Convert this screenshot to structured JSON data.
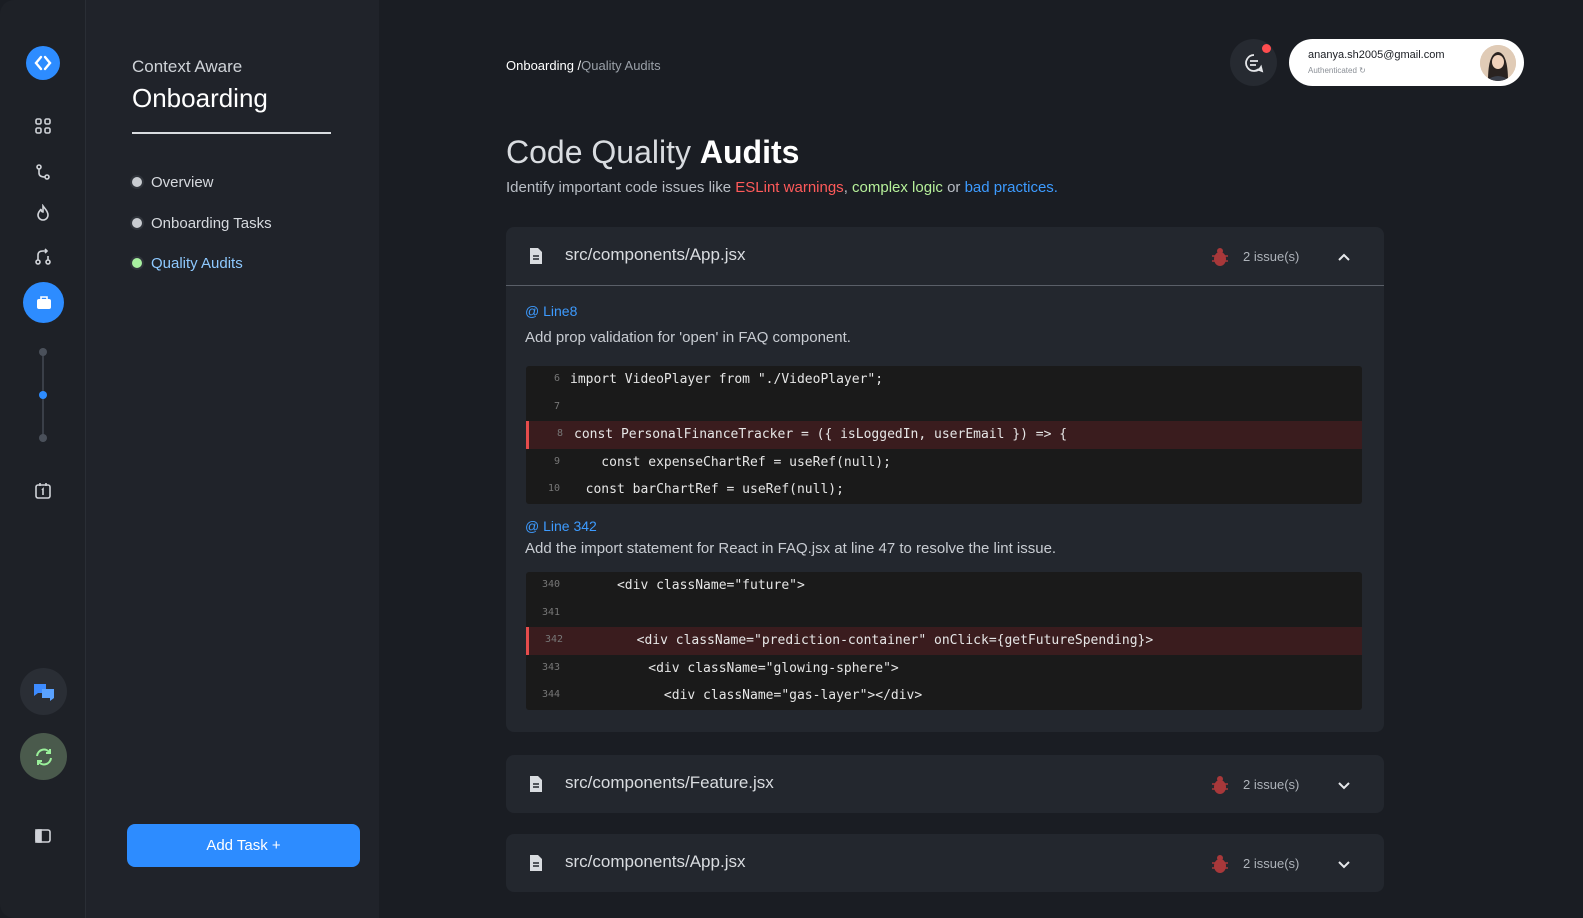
{
  "sidebar": {
    "subtitle": "Context Aware",
    "title": "Onboarding",
    "items": [
      {
        "label": "Overview",
        "active": false
      },
      {
        "label": "Onboarding Tasks",
        "active": false
      },
      {
        "label": "Quality Audits",
        "active": true
      }
    ],
    "add_task_label": "Add Task +"
  },
  "rail": {
    "icons": [
      "logo-icon",
      "dashboard-icon",
      "git-branch-icon",
      "flame-icon",
      "pull-request-icon",
      "briefcase-icon",
      "calendar-icon",
      "chat-icon",
      "sync-icon",
      "sidebar-toggle-icon"
    ]
  },
  "header": {
    "breadcrumb_root": "Onboarding /",
    "breadcrumb_current": "Quality Audits",
    "user_email": "ananya.sh2005@gmail.com",
    "user_status": "Authenticated"
  },
  "page": {
    "title_light": "Code Quality ",
    "title_bold": "Audits",
    "desc_prefix": "Identify important code issues like ",
    "desc_red": "ESLint warnings",
    "desc_comma": ", ",
    "desc_green": "complex logic",
    "desc_or": " or ",
    "desc_blue": "bad practices."
  },
  "files": [
    {
      "name": "src/components/App.jsx",
      "issues_label": "2 issue(s)",
      "expanded": true,
      "issues": [
        {
          "line_label": "@ Line8",
          "message": "Add prop validation for 'open' in FAQ component.",
          "code": [
            {
              "n": "6",
              "text": "import VideoPlayer from \"./VideoPlayer\";",
              "hl": false
            },
            {
              "n": "7",
              "text": "",
              "hl": false
            },
            {
              "n": "8",
              "text": "const PersonalFinanceTracker = ({ isLoggedIn, userEmail }) => {",
              "hl": true
            },
            {
              "n": "9",
              "text": "    const expenseChartRef = useRef(null);",
              "hl": false
            },
            {
              "n": "10",
              "text": "  const barChartRef = useRef(null);",
              "hl": false
            }
          ]
        },
        {
          "line_label": "@ Line 342",
          "message": "Add the import statement for React in FAQ.jsx at line 47 to resolve the lint issue.",
          "code": [
            {
              "n": "340",
              "text": "      <div className=\"future\">",
              "hl": false
            },
            {
              "n": "341",
              "text": "",
              "hl": false
            },
            {
              "n": "342",
              "text": "        <div className=\"prediction-container\" onClick={getFutureSpending}>",
              "hl": true
            },
            {
              "n": "343",
              "text": "          <div className=\"glowing-sphere\">",
              "hl": false
            },
            {
              "n": "344",
              "text": "            <div className=\"gas-layer\"></div>",
              "hl": false
            }
          ]
        }
      ]
    },
    {
      "name": "src/components/Feature.jsx",
      "issues_label": "2 issue(s)",
      "expanded": false
    },
    {
      "name": "src/components/App.jsx",
      "issues_label": "2 issue(s)",
      "expanded": false
    }
  ],
  "colors": {
    "accent": "#2d8cff",
    "error": "#ff5a5a",
    "success": "#b6f09a"
  }
}
